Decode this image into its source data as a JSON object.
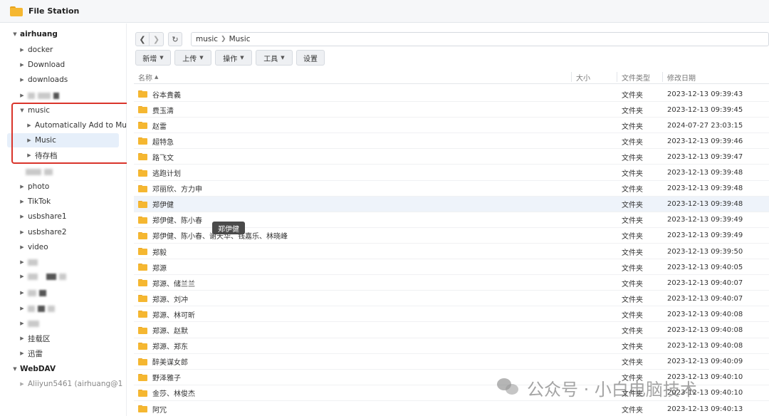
{
  "window": {
    "title": "File Station"
  },
  "sidebar": {
    "root1": "airhuang",
    "items": {
      "docker": "docker",
      "download": "Download",
      "downloads": "downloads",
      "music": "music",
      "auto_add": "Automatically Add to Mu",
      "music_sub": "Music",
      "pending": "待存档",
      "photo": "photo",
      "tiktok": "TikTok",
      "usbshare1": "usbshare1",
      "usbshare2": "usbshare2",
      "video": "video",
      "mount": "挂载区",
      "xunlei": "迅雷"
    },
    "root2": "WebDAV",
    "webdav_item": "Aliiyun5461 (airhuang@1"
  },
  "nav": {
    "path": [
      "music",
      "Music"
    ]
  },
  "toolbar": {
    "new": "新增",
    "upload": "上传",
    "action": "操作",
    "tools": "工具",
    "settings": "设置"
  },
  "columns": {
    "name": "名称",
    "size": "大小",
    "type": "文件类型",
    "modified": "修改日期"
  },
  "files": [
    {
      "name": "谷本貴義",
      "type": "文件夹",
      "modified": "2023-12-13 09:39:43"
    },
    {
      "name": "费玉清",
      "type": "文件夹",
      "modified": "2023-12-13 09:39:45"
    },
    {
      "name": "赵雷",
      "type": "文件夹",
      "modified": "2024-07-27 23:03:15"
    },
    {
      "name": "超特急",
      "type": "文件夹",
      "modified": "2023-12-13 09:39:46"
    },
    {
      "name": "路飞文",
      "type": "文件夹",
      "modified": "2023-12-13 09:39:47"
    },
    {
      "name": "逃跑计划",
      "type": "文件夹",
      "modified": "2023-12-13 09:39:48"
    },
    {
      "name": "邓丽欣、方力申",
      "type": "文件夹",
      "modified": "2023-12-13 09:39:48"
    },
    {
      "name": "郑伊健",
      "type": "文件夹",
      "modified": "2023-12-13 09:39:48"
    },
    {
      "name": "郑伊健、陈小春",
      "type": "文件夹",
      "modified": "2023-12-13 09:39:49"
    },
    {
      "name": "郑伊健、陈小春、谢天华、钱嘉乐、林晓峰",
      "type": "文件夹",
      "modified": "2023-12-13 09:39:49"
    },
    {
      "name": "郑毅",
      "type": "文件夹",
      "modified": "2023-12-13 09:39:50"
    },
    {
      "name": "郑源",
      "type": "文件夹",
      "modified": "2023-12-13 09:40:05"
    },
    {
      "name": "郑源、储兰兰",
      "type": "文件夹",
      "modified": "2023-12-13 09:40:07"
    },
    {
      "name": "郑源、刘冲",
      "type": "文件夹",
      "modified": "2023-12-13 09:40:07"
    },
    {
      "name": "郑源、林可昕",
      "type": "文件夹",
      "modified": "2023-12-13 09:40:08"
    },
    {
      "name": "郑源、赵默",
      "type": "文件夹",
      "modified": "2023-12-13 09:40:08"
    },
    {
      "name": "郑源、郑东",
      "type": "文件夹",
      "modified": "2023-12-13 09:40:08"
    },
    {
      "name": "醉美谋女郎",
      "type": "文件夹",
      "modified": "2023-12-13 09:40:09"
    },
    {
      "name": "野泽雅子",
      "type": "文件夹",
      "modified": "2023-12-13 09:40:10"
    },
    {
      "name": "金莎、林俊杰",
      "type": "文件夹",
      "modified": "2023-12-13 09:40:10"
    },
    {
      "name": "阿冗",
      "type": "文件夹",
      "modified": "2023-12-13 09:40:13"
    }
  ],
  "tooltip": "郑伊健",
  "watermark": "公众号 · 小白电脑技术"
}
